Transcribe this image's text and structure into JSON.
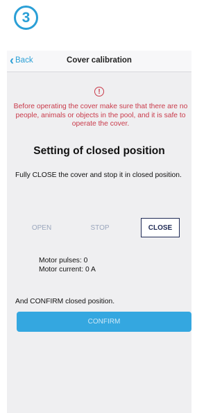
{
  "step": {
    "number": "3"
  },
  "navbar": {
    "back_label": "Back",
    "title": "Cover calibration"
  },
  "warning": {
    "icon": "!",
    "text": "Before operating the cover make sure that there are no people, animals or objects in the pool, and it is safe to operate the cover."
  },
  "section": {
    "heading": "Setting of closed position",
    "instruction": "Fully CLOSE the cover and stop it in closed position."
  },
  "controls": {
    "open": "OPEN",
    "stop": "STOP",
    "close": "CLOSE"
  },
  "motor": {
    "pulses": "Motor pulses: 0",
    "current": "Motor current: 0 A"
  },
  "confirm": {
    "prompt": "And CONFIRM closed position.",
    "button": "CONFIRM"
  },
  "colors": {
    "accent": "#2a9fd6",
    "warning": "#c93a4a",
    "confirm_bg": "#34a7e0",
    "close_border": "#1f2a55"
  }
}
